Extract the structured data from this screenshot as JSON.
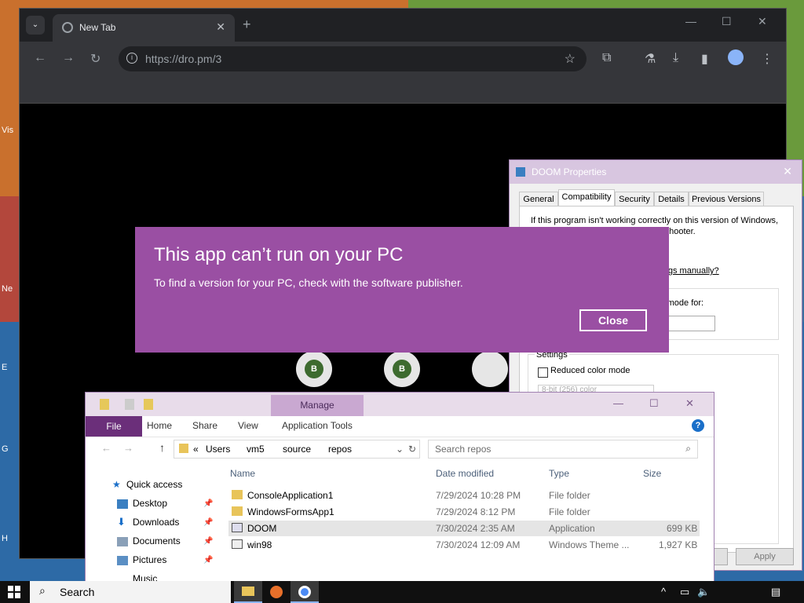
{
  "chrome": {
    "tab_title": "New Tab",
    "tab_close": "✕",
    "new_tab": "+",
    "url_host": "https://dro.pm",
    "url_path": "/3",
    "circle_labels": [
      "B",
      "B"
    ]
  },
  "icons": {
    "search": "⌄",
    "back": "←",
    "forward": "→",
    "reload": "↻",
    "star": "☆",
    "extensions": "⧉",
    "labs": "⚗",
    "download": "⤓",
    "sidepanel": "▮",
    "menu": "⋮",
    "minimize": "—",
    "maximize": "☐",
    "close": "✕"
  },
  "properties": {
    "title": "DOOM Properties",
    "tabs": [
      "General",
      "Compatibility",
      "Security",
      "Details",
      "Previous Versions"
    ],
    "selected_tab": "Compatibility",
    "line1": "If this program isn't working correctly on this version of Windows,",
    "line2": "try running the compatibility troubleshooter.",
    "manual_link": "How do I choose compatibility settings manually?",
    "mode_label": "Run this program in compatibility mode for:",
    "settings_label": "Settings",
    "reduced_color": "Reduced color mode",
    "color_select": "8-bit (256) color",
    "apply_label": "Apply"
  },
  "error_dialog": {
    "title": "This app can’t run on your PC",
    "message": "To find a version for your PC, check with the software publisher.",
    "close_label": "Close"
  },
  "explorer": {
    "manage_label": "Manage",
    "ribbon_tabs": [
      "File",
      "Home",
      "Share",
      "View",
      "Application Tools"
    ],
    "breadcrumb": [
      "«",
      "Users",
      "vm5",
      "source",
      "repos"
    ],
    "search_placeholder": "Search repos",
    "nav": [
      {
        "label": "Quick access"
      },
      {
        "label": "Desktop"
      },
      {
        "label": "Downloads"
      },
      {
        "label": "Documents"
      },
      {
        "label": "Pictures"
      },
      {
        "label": "Music"
      }
    ],
    "columns": [
      "Name",
      "Date modified",
      "Type",
      "Size"
    ],
    "rows": [
      {
        "name": "ConsoleApplication1",
        "date": "7/29/2024 10:28 PM",
        "type": "File folder",
        "size": ""
      },
      {
        "name": "WindowsFormsApp1",
        "date": "7/29/2024 8:12 PM",
        "type": "File folder",
        "size": ""
      },
      {
        "name": "DOOM",
        "date": "7/30/2024 2:35 AM",
        "type": "Application",
        "size": "699 KB"
      },
      {
        "name": "win98",
        "date": "7/30/2024 12:09 AM",
        "type": "Windows Theme ...",
        "size": "1,927 KB"
      }
    ]
  },
  "taskbar": {
    "search_label": "Search"
  },
  "desktop": {
    "labels": [
      "Vis",
      "Ne",
      "E",
      "G",
      "H"
    ]
  }
}
